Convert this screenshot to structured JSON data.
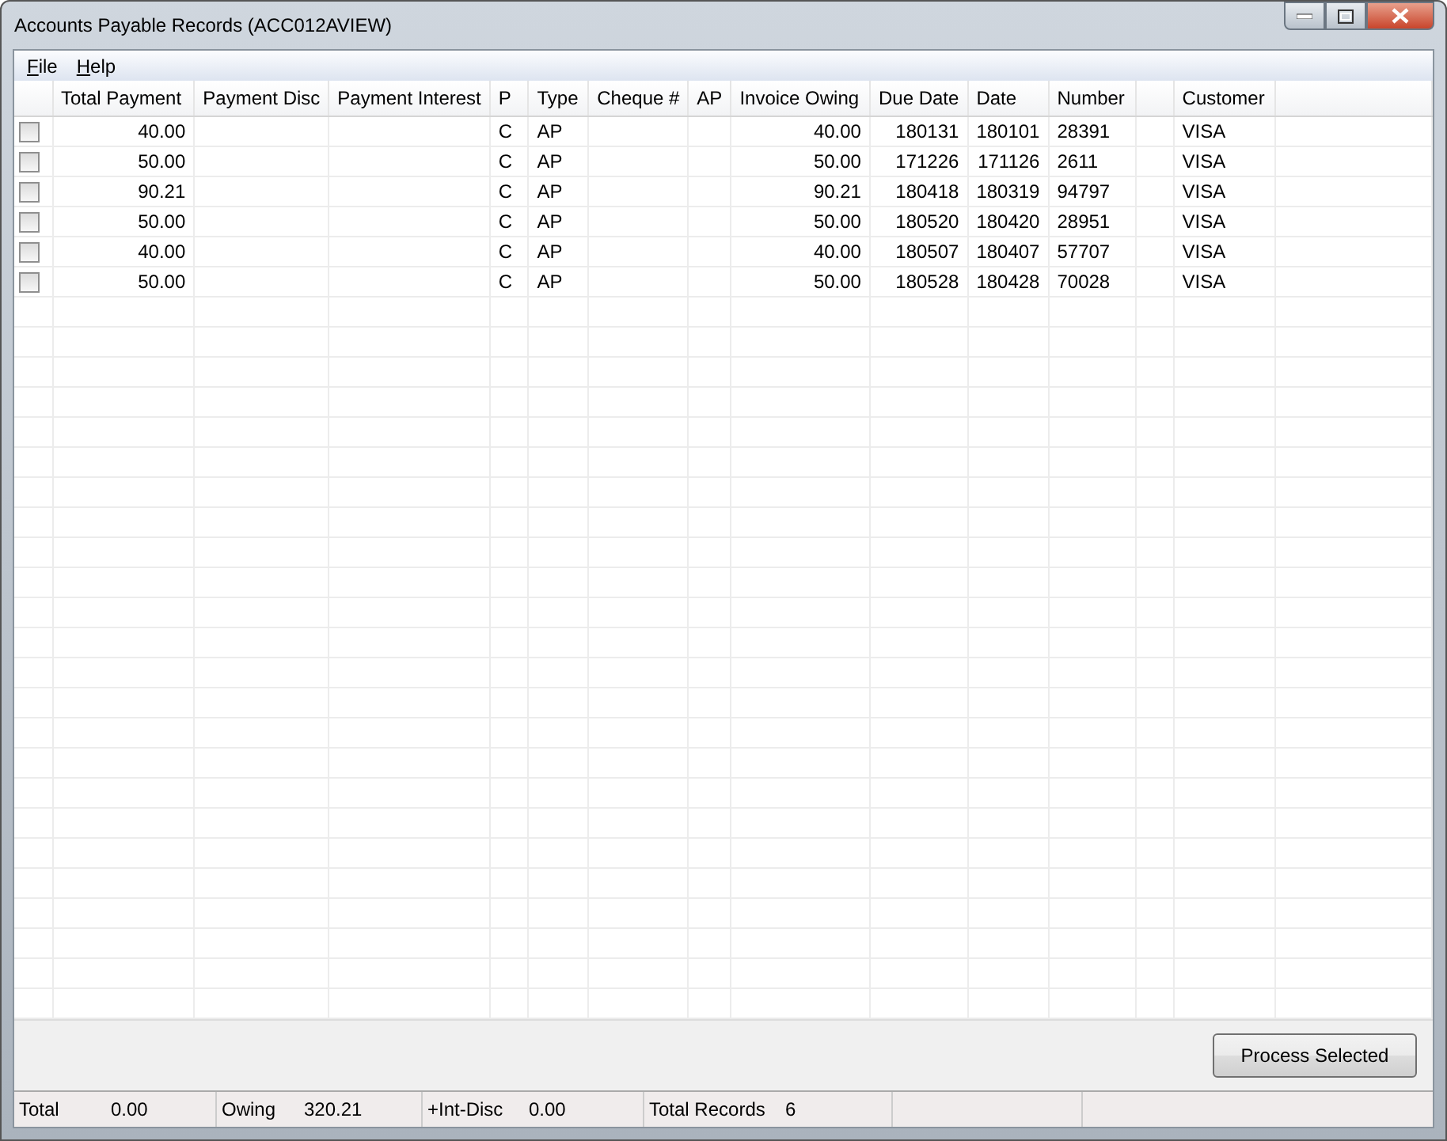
{
  "window": {
    "title": "Accounts Payable Records (ACC012AVIEW)"
  },
  "menu": [
    "File",
    "Help"
  ],
  "table": {
    "columns": [
      "Total Payment",
      "Payment Disc",
      "Payment Interest",
      "P",
      "Type",
      "Cheque #",
      "AP",
      "Invoice Owing",
      "Due Date",
      "Date",
      "Number",
      "",
      "Customer"
    ],
    "rows": [
      {
        "checked": false,
        "cells": [
          "40.00",
          "",
          "",
          "C",
          "AP",
          "",
          "",
          "40.00",
          "180131",
          "180101",
          "28391",
          "",
          "VISA"
        ]
      },
      {
        "checked": false,
        "cells": [
          "50.00",
          "",
          "",
          "C",
          "AP",
          "",
          "",
          "50.00",
          "171226",
          "171126",
          "2611",
          "",
          "VISA"
        ]
      },
      {
        "checked": false,
        "cells": [
          "90.21",
          "",
          "",
          "C",
          "AP",
          "",
          "",
          "90.21",
          "180418",
          "180319",
          "94797",
          "",
          "VISA"
        ]
      },
      {
        "checked": false,
        "cells": [
          "50.00",
          "",
          "",
          "C",
          "AP",
          "",
          "",
          "50.00",
          "180520",
          "180420",
          "28951",
          "",
          "VISA"
        ]
      },
      {
        "checked": false,
        "cells": [
          "40.00",
          "",
          "",
          "C",
          "AP",
          "",
          "",
          "40.00",
          "180507",
          "180407",
          "57707",
          "",
          "VISA"
        ]
      },
      {
        "checked": false,
        "cells": [
          "50.00",
          "",
          "",
          "C",
          "AP",
          "",
          "",
          "50.00",
          "180528",
          "180428",
          "70028",
          "",
          "VISA"
        ]
      }
    ]
  },
  "buttons": [
    "Process Selected"
  ],
  "status_bar": [
    {
      "label": "Total",
      "value": "0.00"
    },
    {
      "label": "Owing",
      "value": "320.21"
    },
    {
      "label": "+Int-Disc",
      "value": "0.00"
    },
    {
      "label": "Total Records",
      "value": "6"
    }
  ]
}
